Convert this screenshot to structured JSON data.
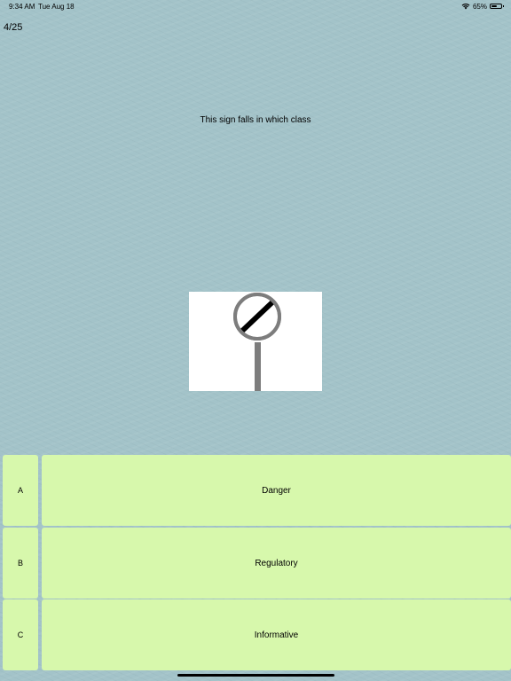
{
  "status_bar": {
    "time": "9:34 AM",
    "date": "Tue Aug 18",
    "battery_text": "65%",
    "battery_level": 0.65,
    "wifi_icon": "wifi-icon",
    "battery_icon": "battery-icon"
  },
  "quiz": {
    "progress": "4/25",
    "question": "This sign falls in which class",
    "sign_icon": "end-of-restriction-sign-icon",
    "answers": [
      {
        "letter": "A",
        "text": "Danger"
      },
      {
        "letter": "B",
        "text": "Regulatory"
      },
      {
        "letter": "C",
        "text": "Informative"
      }
    ]
  },
  "colors": {
    "background": "#a3c3c9",
    "answer_background": "#d7f8ac",
    "sign_ring": "#7d7d7d",
    "sign_bar": "#000000"
  }
}
